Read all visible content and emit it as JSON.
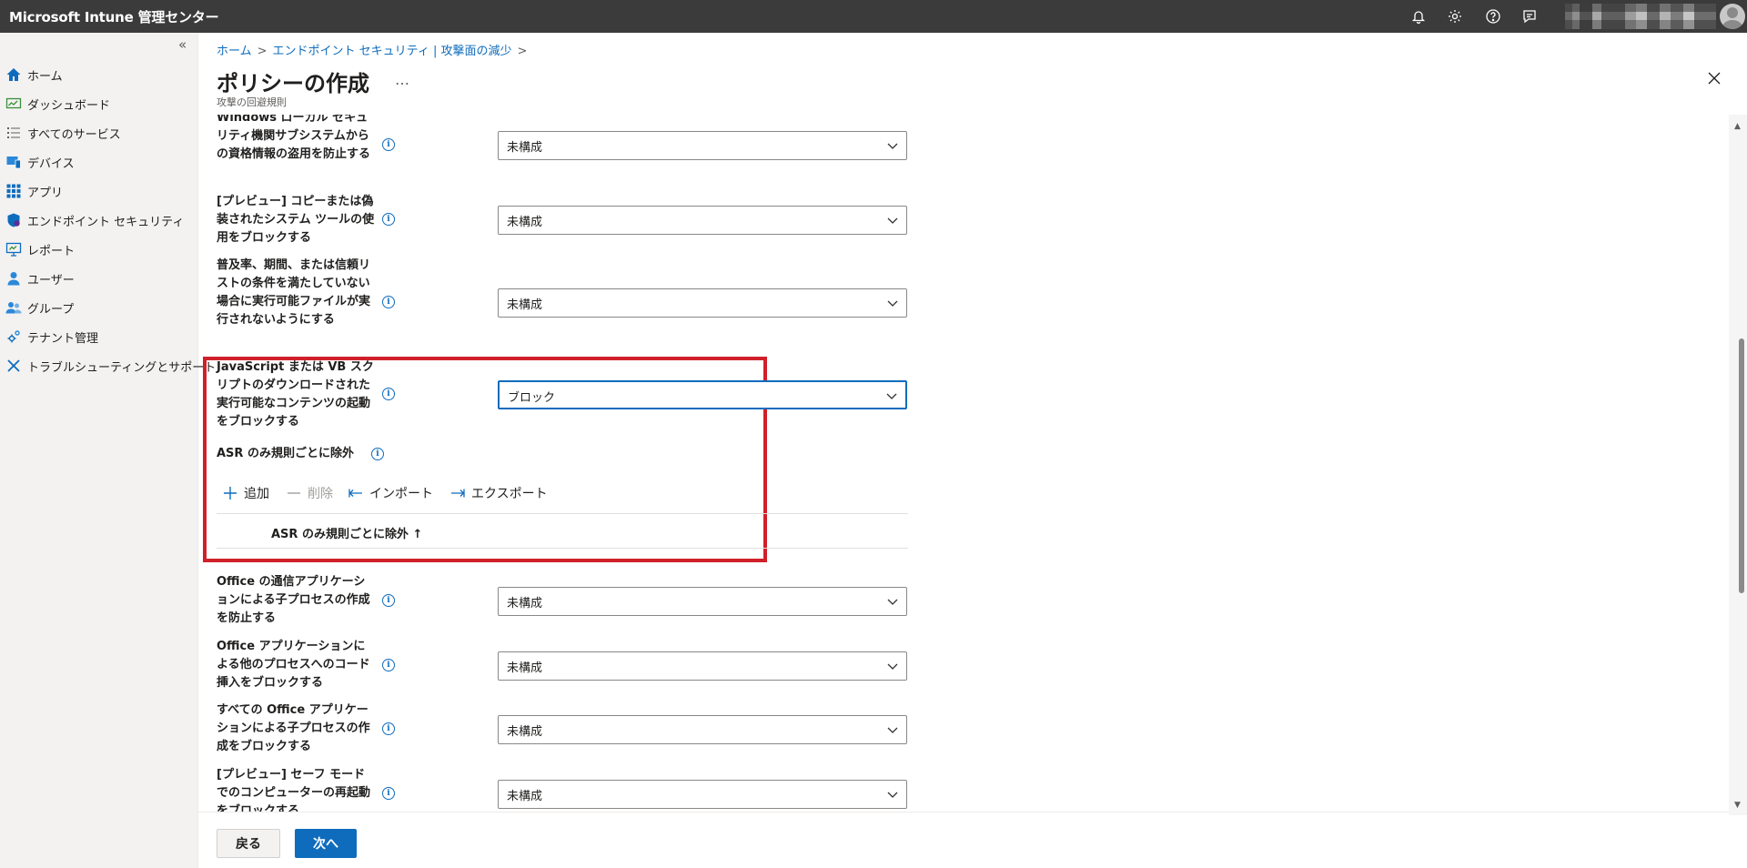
{
  "header": {
    "app_title": "Microsoft Intune 管理センター",
    "icons": [
      "bell-icon",
      "gear-icon",
      "help-icon",
      "feedback-icon"
    ]
  },
  "sidebar": {
    "collapse_label": "«",
    "items": [
      {
        "label": "ホーム",
        "icon": "home-icon"
      },
      {
        "label": "ダッシュボード",
        "icon": "dashboard-icon"
      },
      {
        "label": "すべてのサービス",
        "icon": "list-icon"
      },
      {
        "label": "デバイス",
        "icon": "device-icon"
      },
      {
        "label": "アプリ",
        "icon": "apps-icon"
      },
      {
        "label": "エンドポイント セキュリティ",
        "icon": "shield-icon"
      },
      {
        "label": "レポート",
        "icon": "report-icon"
      },
      {
        "label": "ユーザー",
        "icon": "user-icon"
      },
      {
        "label": "グループ",
        "icon": "group-icon"
      },
      {
        "label": "テナント管理",
        "icon": "tenant-icon"
      },
      {
        "label": "トラブルシューティングとサポート",
        "icon": "tools-icon"
      }
    ]
  },
  "breadcrumb": {
    "items": [
      "ホーム",
      "エンドポイント セキュリティ | 攻撃面の減少"
    ],
    "separator": ">"
  },
  "page": {
    "title": "ポリシーの作成",
    "more": "…",
    "subtitle": "攻撃の回避規則"
  },
  "settings": [
    {
      "label": "Windows ローカル セキュリティ機関サブシステムからの資格情報の盗用を防止する",
      "value": "未構成"
    },
    {
      "label": "[プレビュー] コピーまたは偽装されたシステム ツールの使用をブロックする",
      "value": "未構成"
    },
    {
      "label": "普及率、期間、または信頼リストの条件を満たしていない場合に実行可能ファイルが実行されないようにする",
      "value": "未構成"
    },
    {
      "label": "JavaScript または VB スクリプトのダウンロードされた実行可能なコンテンツの起動をブロックする",
      "value": "ブロック"
    },
    {
      "label": "Office の通信アプリケーションによる子プロセスの作成を防止する",
      "value": "未構成"
    },
    {
      "label": "Office アプリケーションによる他のプロセスへのコード挿入をブロックする",
      "value": "未構成"
    },
    {
      "label": "すべての Office アプリケーションによる子プロセスの作成をブロックする",
      "value": "未構成"
    },
    {
      "label": "[プレビュー] セーフ モードでのコンピューターの再起動をブロックする",
      "value": "未構成"
    }
  ],
  "exclusions": {
    "label": "ASR のみ規則ごとに除外",
    "toolbar": {
      "add": "追加",
      "delete": "削除",
      "import": "インポート",
      "export": "エクスポート"
    },
    "column_header": "ASR のみ規則ごとに除外 ↑"
  },
  "footer": {
    "back": "戻る",
    "next": "次へ"
  },
  "colors": {
    "topbar": "#3b3b3b",
    "accent": "#0f6cbd",
    "highlight": "#d0202a"
  }
}
